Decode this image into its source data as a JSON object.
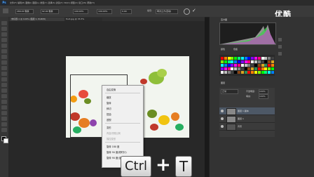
{
  "app": {
    "logo": "Ps"
  },
  "menubar": {
    "menus": "文件(F)  编辑(E)  图像(I)  图层(L)  类型(Y)  选择(S)  滤镜(T)  3D(D)  视图(V)  窗口(W)  帮助(H)"
  },
  "options": {
    "x_value": "266.00 像素",
    "y_value": "92.00 像素",
    "w_value": "100.00%",
    "h_value": "100.00%",
    "angle_value": "0.00",
    "interp_label": "插值:",
    "interp_value": "两次立方(自动)"
  },
  "tabs": [
    {
      "label": "未标题-1 @ 100% (图层 1, RGB/8)"
    },
    {
      "label": "fruit.jpg @ 33.3%"
    }
  ],
  "panel": {
    "histogram_tab": "直方图",
    "swatches_tab1": "颜色",
    "swatches_tab2": "色板",
    "layers_tab": "图层",
    "blend_mode": "正常",
    "opacity_label": "不透明度:",
    "opacity_value": "100%",
    "fill_label": "填充:",
    "fill_value": "100%",
    "layers": [
      {
        "name": "图层 1 副本"
      },
      {
        "name": "图层 1"
      },
      {
        "name": "背景"
      }
    ]
  },
  "context_menu": {
    "items": [
      {
        "label": "自由变换",
        "disabled": false
      },
      {
        "label": "缩放",
        "disabled": false
      },
      {
        "label": "旋转",
        "disabled": false
      },
      {
        "label": "斜切",
        "disabled": false
      },
      {
        "label": "扭曲",
        "disabled": false
      },
      {
        "label": "透视",
        "disabled": false
      },
      {
        "label": "变形",
        "disabled": false
      },
      {
        "label": "内容识别比例",
        "disabled": true
      },
      {
        "label": "操控变形",
        "disabled": true
      },
      {
        "label": "旋转 180 度",
        "disabled": false
      },
      {
        "label": "旋转 90 度(顺时针)",
        "disabled": false
      },
      {
        "label": "旋转 90 度(逆时针)",
        "disabled": false
      }
    ]
  },
  "watermark": "优酷",
  "shortcut": {
    "key1": "Ctrl",
    "plus": "+",
    "key2": "T"
  },
  "colors": {
    "accent": "#4aa3ff",
    "selected_layer": "#4d5866"
  }
}
